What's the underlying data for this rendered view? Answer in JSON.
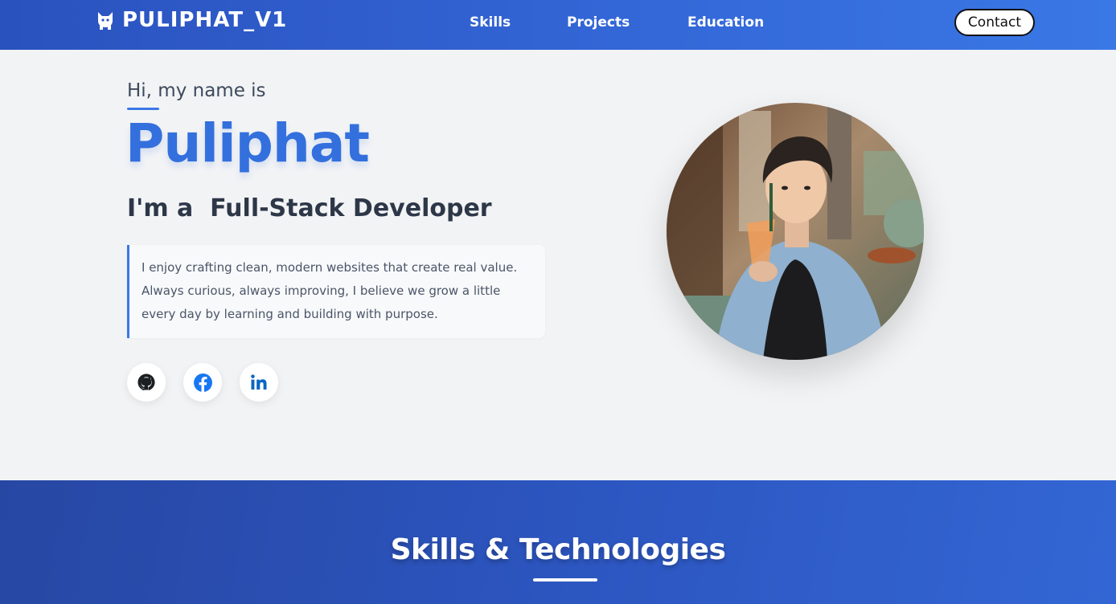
{
  "nav": {
    "brand": "PULIPHAT_V1",
    "links": [
      {
        "label": "Skills"
      },
      {
        "label": "Projects"
      },
      {
        "label": "Education"
      }
    ],
    "contact_label": "Contact"
  },
  "hero": {
    "greeting": "Hi, my name is",
    "name": "Puliphat",
    "role": "I'm a  Full-Stack Developer",
    "bio": "I enjoy crafting clean, modern websites that create real value. Always curious, always improving, I believe we grow a little every day by learning and building with purpose.",
    "socials": [
      {
        "icon": "github-icon"
      },
      {
        "icon": "facebook-icon"
      },
      {
        "icon": "linkedin-icon"
      }
    ],
    "avatar": "profile-photo"
  },
  "skills": {
    "title": "Skills & Technologies"
  },
  "colors": {
    "accent": "#3470dd",
    "nav_gradient_start": "#2a52be",
    "nav_gradient_end": "#3a78e6",
    "section_bg": "#2c55bf"
  }
}
